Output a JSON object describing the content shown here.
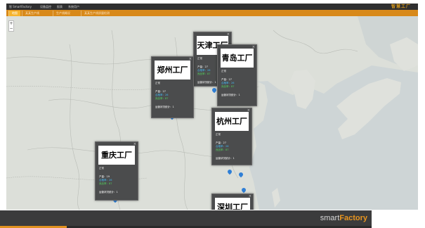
{
  "topbar": {
    "brand": "智 SmartFactory",
    "menu": [
      "设备监控",
      "报表",
      "系统用户"
    ],
    "logo_cn": "智慧工厂"
  },
  "tabs": [
    "地图",
    "某某生产线",
    "生产线概况",
    "某某生产线质量检测"
  ],
  "map": {
    "zoom_in": "+",
    "zoom_out": "−"
  },
  "factories": [
    {
      "title": "郑州工厂",
      "sub": "正常",
      "line1": "产量：27",
      "line2": "合格率：26",
      "line3": "良品率：87",
      "line4": "运营状况统计：1"
    },
    {
      "title": "天津工厂",
      "sub": "正常",
      "line1": "产量：27",
      "line2": "合格率：26",
      "line3": "良品率：87",
      "line4": "运营状况统计：1"
    },
    {
      "title": "青岛工厂",
      "sub": "正常",
      "line1": "产量：27",
      "line2": "合格率：26",
      "line3": "良品率：87",
      "line4": "运营状况统计：1"
    },
    {
      "title": "杭州工厂",
      "sub": "正常",
      "line1": "产量：27",
      "line2": "合格率：26",
      "line3": "良品率：87",
      "line4": "运营状况统计：1"
    },
    {
      "title": "重庆工厂",
      "sub": "正常",
      "line1": "产量：19",
      "line2": "合格率：26",
      "line3": "良品率：87",
      "line4": "运营状况统计：1"
    },
    {
      "title": "深圳工厂",
      "sub": "",
      "line1": "",
      "line2": "",
      "line3": "",
      "line4": ""
    }
  ],
  "footer": {
    "brand_light": "smart",
    "brand_bold": "Factory"
  },
  "colors": {
    "accent": "#d8891a",
    "panel": "#4b4c4d",
    "cyan": "#43b6f0",
    "green": "#54d25f",
    "pin": "#2f7fd6"
  },
  "icons": {
    "close": "close-icon",
    "pin": "map-pin-icon"
  }
}
